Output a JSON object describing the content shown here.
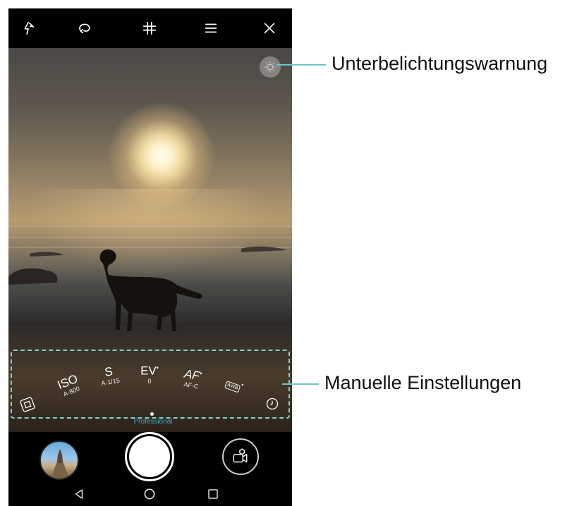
{
  "top_bar": {
    "icons": [
      "flash-off-icon",
      "rotate-icon",
      "grid-icon",
      "menu-icon",
      "close-icon"
    ]
  },
  "viewfinder": {
    "warning_icon": "exposure-warning-icon"
  },
  "manual_settings": {
    "params": [
      {
        "label": "ISO",
        "value": "A-800"
      },
      {
        "label": "S",
        "value": "A-1/15"
      },
      {
        "label": "EV",
        "value": "0"
      },
      {
        "label": "AF",
        "value": "AF-C"
      },
      {
        "label": "AWB",
        "value": ""
      }
    ],
    "mode_label": "Professional",
    "colors": {
      "dash": "#7fd0d6",
      "mode_label": "#3ec6e6"
    }
  },
  "bottom": {
    "icons": [
      "gallery-thumbnail",
      "shutter-button",
      "video-mode-icon"
    ]
  },
  "navbar": {
    "icons": [
      "back-icon",
      "home-icon",
      "recents-icon"
    ]
  },
  "callouts": {
    "underexposure": "Unterbelichtungswarnung",
    "manual": "Manuelle Einstellungen",
    "line_color": "#6ec6cd"
  }
}
